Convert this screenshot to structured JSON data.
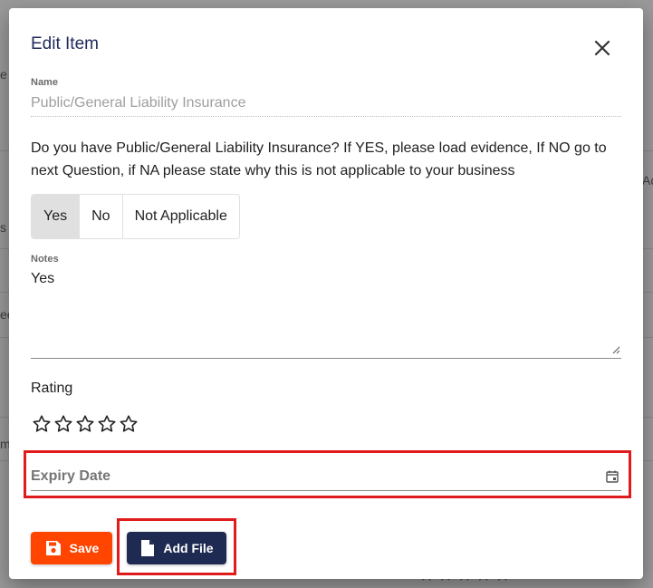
{
  "background": {
    "fragments": [
      "e c",
      "Ac",
      "s",
      "ee",
      "m"
    ],
    "stars": "☆☆☆☆☆"
  },
  "modal": {
    "title": "Edit Item",
    "name_label": "Name",
    "name_value": "Public/General Liability Insurance",
    "question": "Do you have Public/General Liability Insurance? If YES, please load evidence, If NO go to next Question, if NA please state why this is not applicable to your business",
    "options": [
      "Yes",
      "No",
      "Not Applicable"
    ],
    "selected_option": "Yes",
    "notes_label": "Notes",
    "notes_value": "Yes",
    "rating_label": "Rating",
    "rating_value": 0,
    "rating_max": 5,
    "expiry_label": "Expiry Date",
    "save_label": "Save",
    "add_file_label": "Add File"
  },
  "colors": {
    "title": "#1f2a5c",
    "save_button": "#ff4500",
    "add_file_button": "#1f2a52",
    "highlight": "#e01b1b"
  }
}
